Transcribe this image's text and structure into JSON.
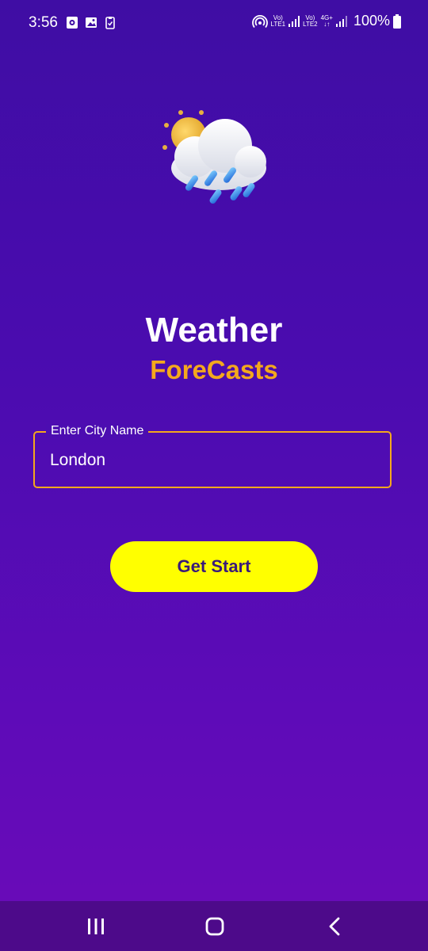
{
  "status_bar": {
    "time": "3:56",
    "sim1_top": "Vo)",
    "sim1_bottom": "LTE1",
    "sim2_top": "Vo)",
    "sim2_bottom": "LTE2",
    "network_type": "4G+",
    "battery": "100%",
    "icons": [
      "notification-icon",
      "gallery-icon",
      "clipboard-icon",
      "hotspot-icon",
      "signal-icon",
      "battery-icon"
    ]
  },
  "app": {
    "title": "Weather",
    "subtitle": "ForeCasts",
    "logo_icon": "weather-cloud-sun-rain-icon"
  },
  "city_input": {
    "label": "Enter City Name",
    "value": "London"
  },
  "start_button": {
    "label": "Get Start"
  },
  "nav": {
    "icons": [
      "recent-apps-icon",
      "home-icon",
      "back-icon"
    ]
  },
  "colors": {
    "accent": "#f4a81d",
    "button_bg": "#ffff00",
    "button_text": "#3a1a7a",
    "background_top": "#3f0da4",
    "background_bottom": "#6b0bb8",
    "nav_bar": "#4d0a8a"
  }
}
